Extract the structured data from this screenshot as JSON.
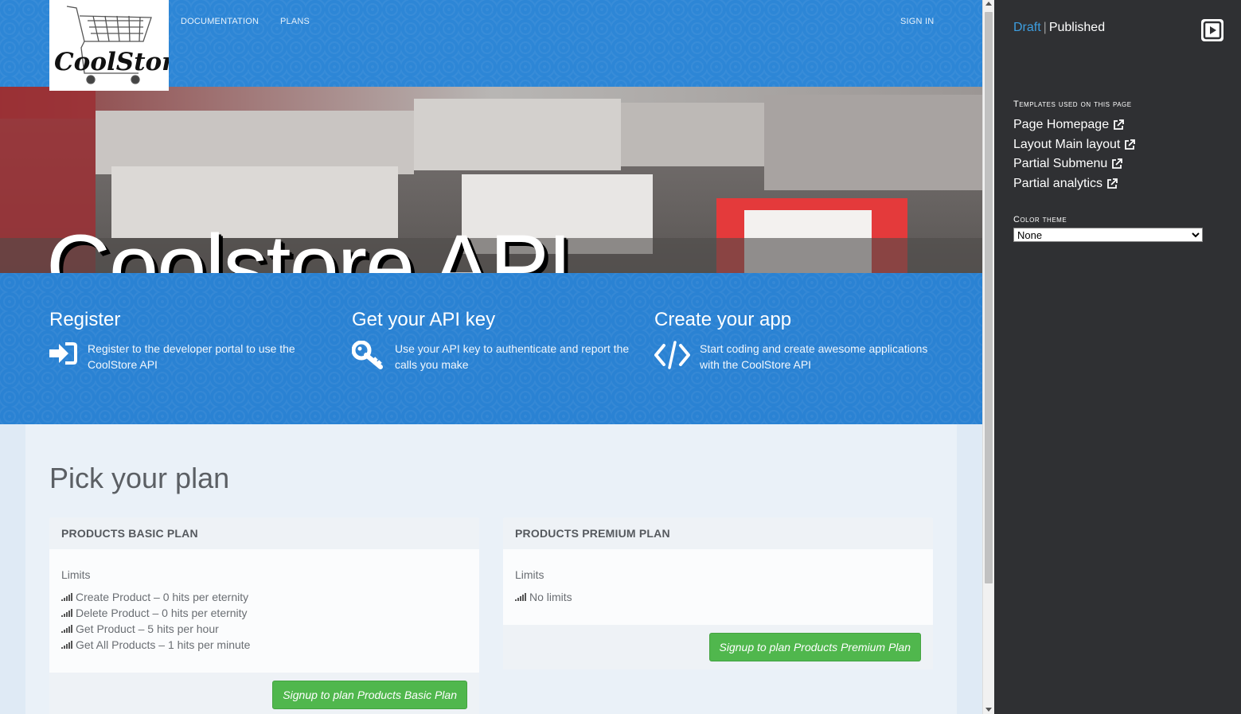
{
  "nav": {
    "logo_text": "CoolStore",
    "links": [
      "DOCUMENTATION",
      "PLANS"
    ],
    "signin": "SIGN IN"
  },
  "hero": {
    "title": "Coolstore API"
  },
  "steps": [
    {
      "title": "Register",
      "text": "Register to the developer portal to use the CoolStore API",
      "icon": "sign-in-icon"
    },
    {
      "title": "Get your API key",
      "text": "Use your API key to authenticate and report the calls you make",
      "icon": "key-icon"
    },
    {
      "title": "Create your app",
      "text": "Start coding and create awesome applications with the CoolStore API",
      "icon": "code-icon"
    }
  ],
  "plans": {
    "title": "Pick your plan",
    "items": [
      {
        "name": "PRODUCTS BASIC PLAN",
        "limits_label": "Limits",
        "limits": [
          "Create Product – 0 hits per eternity",
          "Delete Product – 0 hits per eternity",
          "Get Product – 5 hits per hour",
          "Get All Products – 1 hits per minute"
        ],
        "button": "Signup to plan Products Basic Plan"
      },
      {
        "name": "PRODUCTS PREMIUM PLAN",
        "limits_label": "Limits",
        "limits": [
          "No limits"
        ],
        "button": "Signup to plan Products Premium Plan"
      }
    ]
  },
  "sidebar": {
    "mode_draft": "Draft",
    "mode_separator": "|",
    "mode_published": "Published",
    "templates_heading": "Templates used on this page",
    "templates": [
      "Page Homepage",
      "Layout Main layout",
      "Partial Submenu",
      "Partial analytics"
    ],
    "theme_label": "Color theme",
    "theme_selected": "None"
  },
  "colors": {
    "brand_blue": "#2d86d6",
    "draft_blue": "#3d9ee0",
    "signup_green": "#50b74d",
    "sidebar_bg": "#2f3033"
  }
}
